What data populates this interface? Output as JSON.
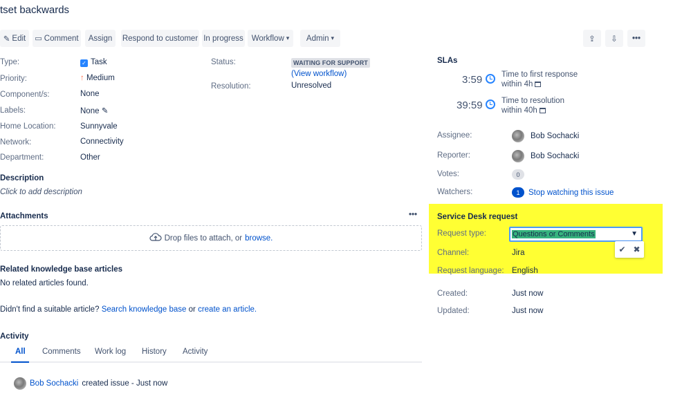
{
  "issue": {
    "title": "tset backwards"
  },
  "toolbar": {
    "edit": "Edit",
    "comment": "Comment",
    "assign": "Assign",
    "respond": "Respond to customer",
    "in_progress": "In progress",
    "workflow": "Workflow",
    "admin": "Admin"
  },
  "details": {
    "type_label": "Type:",
    "type_value": "Task",
    "priority_label": "Priority:",
    "priority_value": "Medium",
    "components_label": "Component/s:",
    "components_value": "None",
    "labels_label": "Labels:",
    "labels_value": "None",
    "home_label": "Home Location:",
    "home_value": "Sunnyvale",
    "network_label": "Network:",
    "network_value": "Connectivity",
    "department_label": "Department:",
    "department_value": "Other",
    "status_label": "Status:",
    "status_value": "WAITING FOR SUPPORT",
    "view_workflow": "(View workflow)",
    "resolution_label": "Resolution:",
    "resolution_value": "Unresolved"
  },
  "description": {
    "heading": "Description",
    "placeholder": "Click to add description"
  },
  "attachments": {
    "heading": "Attachments",
    "drop_text": "Drop files to attach, or",
    "browse": "browse."
  },
  "kb": {
    "heading": "Related knowledge base articles",
    "none": "No related articles found.",
    "prompt": "Didn't find a suitable article?",
    "search_link": "Search knowledge base",
    "or": "or",
    "create_link": "create an article."
  },
  "activity": {
    "heading": "Activity",
    "tabs": [
      "All",
      "Comments",
      "Work log",
      "History",
      "Activity"
    ],
    "entry_user": "Bob Sochacki",
    "entry_text": "created issue - Just now"
  },
  "slas": {
    "heading": "SLAs",
    "items": [
      {
        "time": "3:59",
        "name": "Time to first response",
        "goal": "within 4h"
      },
      {
        "time": "39:59",
        "name": "Time to resolution",
        "goal": "within 40h"
      }
    ]
  },
  "people": {
    "assignee_label": "Assignee:",
    "assignee": "Bob Sochacki",
    "reporter_label": "Reporter:",
    "reporter": "Bob Sochacki",
    "votes_label": "Votes:",
    "votes": "0",
    "watchers_label": "Watchers:",
    "watchers": "1",
    "stop_watching": "Stop watching this issue"
  },
  "service_desk": {
    "heading": "Service Desk request",
    "request_type_label": "Request type:",
    "request_type": "Questions or Comments",
    "channel_label": "Channel:",
    "channel": "Jira",
    "language_label": "Request language:",
    "language": "English"
  },
  "dates": {
    "created_label": "Created:",
    "created": "Just now",
    "updated_label": "Updated:",
    "updated": "Just now"
  },
  "colors": {
    "highlight": "#ffff33",
    "link": "#0052cc",
    "selected": "#36b37e"
  }
}
